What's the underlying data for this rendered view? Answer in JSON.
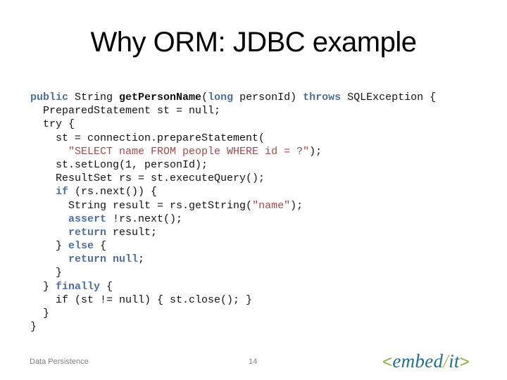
{
  "slide": {
    "title": "Why ORM: JDBC example",
    "code_lines": [
      [
        {
          "t": "public",
          "c": "kw"
        },
        {
          "t": " String "
        },
        {
          "t": "getPersonName",
          "c": "bold"
        },
        {
          "t": "("
        },
        {
          "t": "long",
          "c": "kw"
        },
        {
          "t": " personId) "
        },
        {
          "t": "throws",
          "c": "kw"
        },
        {
          "t": " SQLException {"
        }
      ],
      [
        {
          "t": "  PreparedStatement st = null;"
        }
      ],
      [
        {
          "t": "  try {"
        }
      ],
      [
        {
          "t": "    st = connection.prepareStatement("
        }
      ],
      [
        {
          "t": "      "
        },
        {
          "t": "\"SELECT name FROM people WHERE id = ?\"",
          "c": "str"
        },
        {
          "t": ");"
        }
      ],
      [
        {
          "t": "    st.setLong(1, personId);"
        }
      ],
      [
        {
          "t": "    ResultSet rs = st.executeQuery();"
        }
      ],
      [
        {
          "t": "    "
        },
        {
          "t": "if",
          "c": "kw"
        },
        {
          "t": " (rs.next()) {"
        }
      ],
      [
        {
          "t": "      String result = rs.getString("
        },
        {
          "t": "\"name\"",
          "c": "str"
        },
        {
          "t": ");"
        }
      ],
      [
        {
          "t": "      "
        },
        {
          "t": "assert",
          "c": "kw"
        },
        {
          "t": " !rs.next();"
        }
      ],
      [
        {
          "t": "      "
        },
        {
          "t": "return",
          "c": "kw"
        },
        {
          "t": " result;"
        }
      ],
      [
        {
          "t": "    } "
        },
        {
          "t": "else",
          "c": "kw"
        },
        {
          "t": " {"
        }
      ],
      [
        {
          "t": "      "
        },
        {
          "t": "return null",
          "c": "kw"
        },
        {
          "t": ";"
        }
      ],
      [
        {
          "t": "    }"
        }
      ],
      [
        {
          "t": "  } "
        },
        {
          "t": "finally",
          "c": "kw"
        },
        {
          "t": " {"
        }
      ],
      [
        {
          "t": "    if (st != null) { st.close(); }"
        }
      ],
      [
        {
          "t": "  }"
        }
      ],
      [
        {
          "t": "}"
        }
      ]
    ]
  },
  "footer": {
    "section": "Data Persistence",
    "page_number": "14",
    "logo": {
      "open": "<",
      "word1": "embed",
      "slash": "/",
      "word2": "it",
      "close": ">"
    }
  },
  "colors": {
    "keyword": "#4f6f9a",
    "string": "#9b4b4b",
    "logo_green": "#8aac3e",
    "logo_teal": "#1f6f8b"
  }
}
